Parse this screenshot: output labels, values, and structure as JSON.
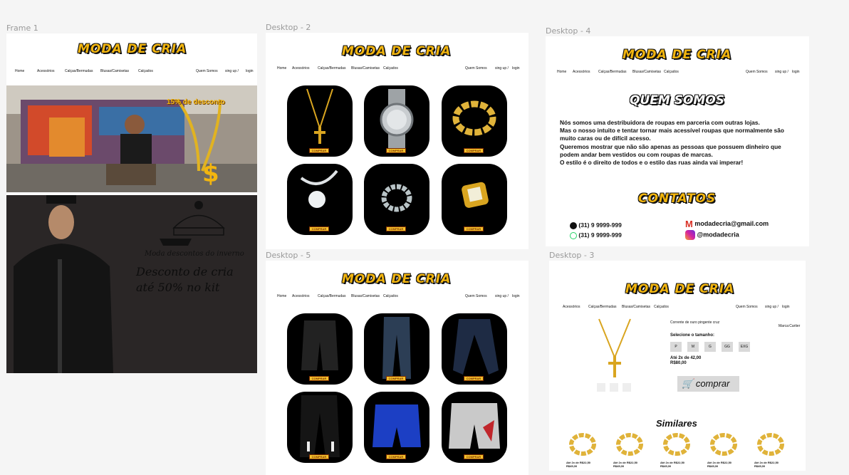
{
  "frames": {
    "frame1": "Frame 1",
    "desktop2": "Desktop - 2",
    "desktop4": "Desktop - 4",
    "desktop5": "Desktop - 5",
    "desktop3": "Desktop - 3"
  },
  "brand": {
    "logo": "MODA DE CRIA"
  },
  "nav": {
    "home": "Home",
    "acessorios": "Acessórios",
    "calcas": "Calças/Bermudas",
    "blusas": "Blusas/Camisetas",
    "calcados": "Calçados",
    "quem_somos": "Quem Somos",
    "sign_up": "sing up /",
    "login": "login"
  },
  "frame1": {
    "promo": "15% de desconto",
    "promo2": "Moda descontos do inverno",
    "discount_line1": "Desconto de cria",
    "discount_line2": "até 50% no kit"
  },
  "product_tag": "COMPRAR",
  "about": {
    "title": "QUEM SOMOS",
    "text": "Nós somos uma destribuidora de roupas em parceria com outras lojas.\nMas o nosso intuito e tentar tornar mais acessível roupas que normalmente são muito caras ou de difícil acesso.\nQueremos mostrar que não são apenas as pessoas que possuem dinheiro que podem andar bem vestidos ou com roupas de marcas.\nO estilo é o direito de todos e o estilo das ruas ainda vai imperar!",
    "contact_title": "CONTATOS",
    "phone1": "(31) 9 9999-999",
    "phone2": "(31) 9 9999-999",
    "email": "modadecria@gmail.com",
    "instagram": "@modadecria"
  },
  "product": {
    "name": "Corrente de ouro pingente cruz",
    "brand": "Marca:Cartier",
    "size_label": "Selecione o tamanho:",
    "sizes": [
      "P",
      "M",
      "G",
      "GG",
      "EXG"
    ],
    "installments": "Até 2x de 42,00",
    "price": "R$80,00",
    "buy": "comprar",
    "similar_title": "Similares",
    "similar_items": [
      {
        "line1": "Até 2x de R$22,50",
        "line2": "R$45,00"
      },
      {
        "line1": "Até 2x de R$22,50",
        "line2": "R$45,00"
      },
      {
        "line1": "Até 2x de R$22,50",
        "line2": "R$45,00"
      },
      {
        "line1": "Até 2x de R$22,50",
        "line2": "R$45,00"
      },
      {
        "line1": "Até 2x de R$22,50",
        "line2": "R$45,00"
      }
    ]
  },
  "colors": {
    "brand_yellow": "#f2b50f",
    "dark_panel": "#2a2626",
    "tile_black": "#000000"
  }
}
